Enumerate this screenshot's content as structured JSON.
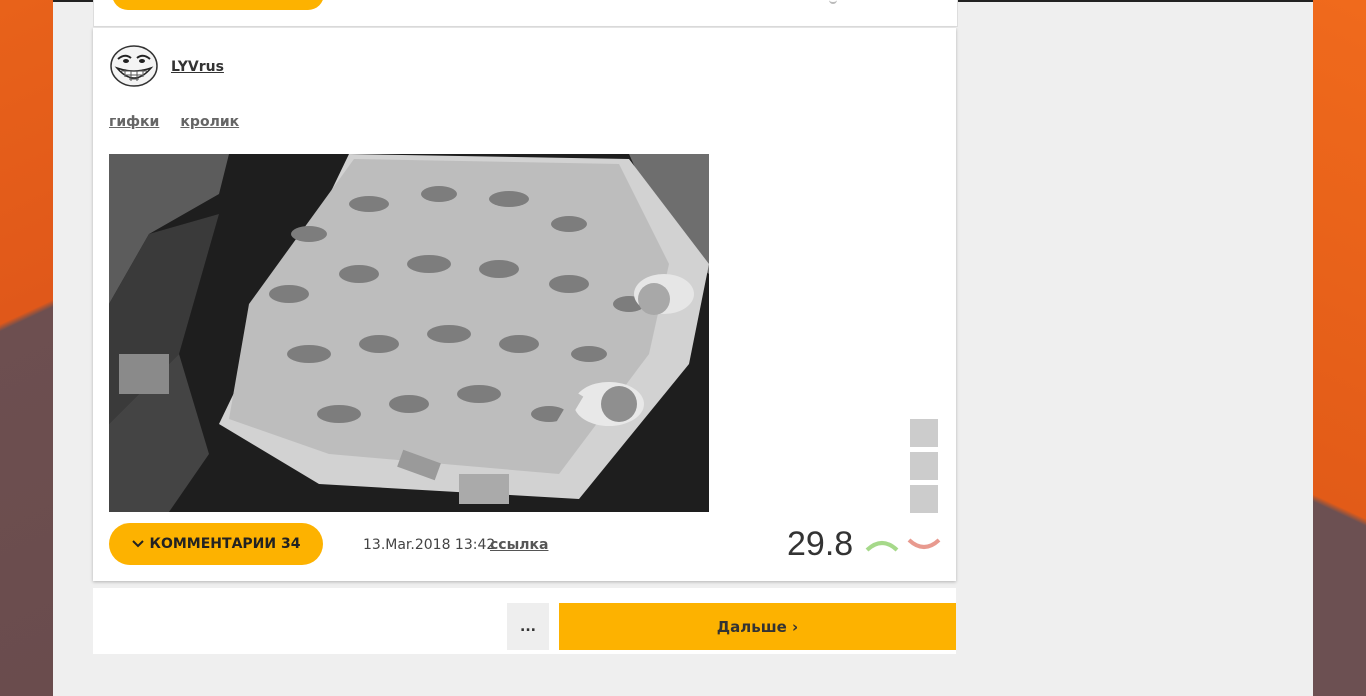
{
  "post": {
    "username": "LYVrus",
    "tags": [
      "гифки",
      "кролик"
    ],
    "comments_label": "КОММЕНТАРИИ 34",
    "date": "13.Mar.2018 13:42",
    "link_label": "ссылка",
    "rating": "29.8"
  },
  "pager": {
    "dots_label": "...",
    "next_label": "Дальше ›"
  },
  "colors": {
    "accent": "#fdb200",
    "vote_up": "#a6d98a",
    "vote_down": "#e89a8f",
    "background_orange": "#e8621a"
  },
  "icons": {
    "avatar": "trollface-avatar",
    "comments_toggle": "chevron-down-icon",
    "vote_up": "chevron-up-icon",
    "vote_down": "chevron-down-icon"
  }
}
